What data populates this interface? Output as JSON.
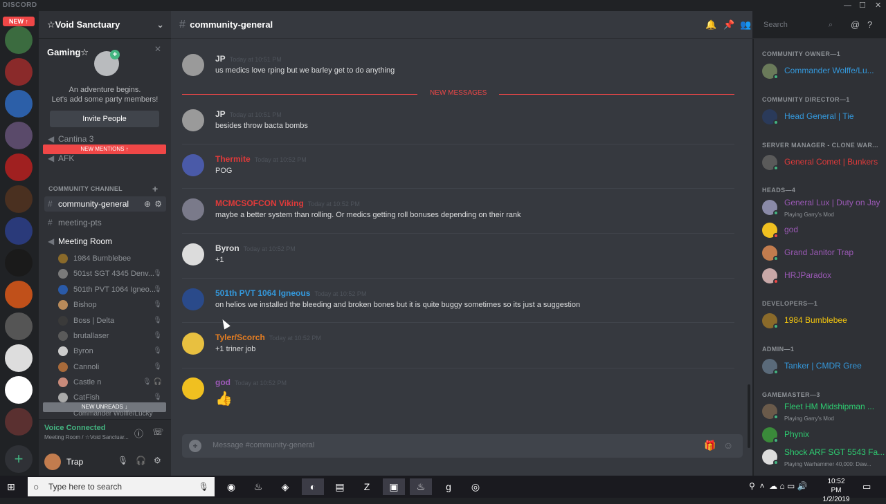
{
  "app": {
    "logo": "DISCORD",
    "minimize": "—",
    "maximize": "☐",
    "close": "✕"
  },
  "guilds": {
    "new_badge": "NEW ↑",
    "add_label": "+"
  },
  "server": {
    "name": "☆Void Sanctuary Gaming☆",
    "chevron": "⌄"
  },
  "invite": {
    "close": "✕",
    "title": "An adventure begins.",
    "subtitle": "Let's add some party members!",
    "button": "Invite People"
  },
  "sidebar": {
    "new_mentions": "NEW MENTIONS ↑",
    "cantina": "Cantina 3",
    "afk": "AFK",
    "category": "COMMUNITY CHANNEL",
    "category_plus": "+",
    "channels": [
      {
        "label": "community-general"
      },
      {
        "label": "meeting-pts"
      }
    ],
    "voice_channel": "Meeting Room",
    "voice_users": [
      "1984 Bumblebee",
      "501st SGT 4345 Denv...",
      "501th PVT 1064 Igneo...",
      "Bishop",
      "Boss | Delta",
      "brutallaser",
      "Byron",
      "Cannoli",
      "Castle n",
      "CatFish",
      "Commander Wolffe/Lucky"
    ],
    "new_unreads": "NEW UNREADS ↓"
  },
  "voice": {
    "status": "Voice Connected",
    "location": "Meeting Room / ☆Void Sanctuar..."
  },
  "user": {
    "name": "Trap"
  },
  "channel": {
    "name": "community-general",
    "search_placeholder": "Search",
    "input_placeholder": "Message #community-general"
  },
  "messages": [
    {
      "author": "JP",
      "time": "Today at 10:51 PM",
      "text": "us medics love rping but we barley get to do anything",
      "color": "#dcddde"
    },
    {
      "author": "JP",
      "time": "Today at 10:51 PM",
      "text": "besides throw bacta bombs",
      "color": "#dcddde"
    },
    {
      "author": "Thermite",
      "time": "Today at 10:52 PM",
      "text": "POG",
      "color": "#e03a3a"
    },
    {
      "author": "MCMCSOFCON Viking",
      "time": "Today at 10:52 PM",
      "text": "maybe a better system than rolling. Or medics getting roll bonuses depending on their rank",
      "color": "#e03a3a"
    },
    {
      "author": "Byron",
      "time": "Today at 10:52 PM",
      "text": "+1",
      "color": "#dcddde"
    },
    {
      "author": "501th PVT 1064 Igneous",
      "time": "Today at 10:52 PM",
      "text": "on helios we installed the bleeding and broken bones but it is quite buggy sometimes so its just a suggestion",
      "color": "#3498db"
    },
    {
      "author": "Tyler/Scorch",
      "time": "Today at 10:52 PM",
      "text": "+1 triner job",
      "color": "#e67e22"
    },
    {
      "author": "god",
      "time": "Today at 10:52 PM",
      "text": "",
      "color": "#9b59b6"
    }
  ],
  "new_messages_label": "NEW MESSAGES",
  "members": {
    "categories": [
      {
        "title": "COMMUNITY OWNER—1"
      },
      {
        "title": "COMMUNITY DIRECTOR—1"
      },
      {
        "title": "SERVER MANAGER - CLONE WAR..."
      },
      {
        "title": "HEADS—4"
      },
      {
        "title": "DEVELOPERS—1"
      },
      {
        "title": "ADMIN—1"
      },
      {
        "title": "GAMEMASTER—3"
      }
    ],
    "list": [
      {
        "name": "Commander Wolffe/Lu...",
        "color": "#3498db",
        "activity": ""
      },
      {
        "name": "Head General | Tie",
        "color": "#3498db",
        "activity": ""
      },
      {
        "name": "General Comet | Bunkers",
        "color": "#e03a3a",
        "activity": ""
      },
      {
        "name": "General Lux | Duty on Jay",
        "color": "#9b59b6",
        "activity": "Playing Garry's Mod"
      },
      {
        "name": "god",
        "color": "#9b59b6",
        "activity": ""
      },
      {
        "name": "Grand Janitor Trap",
        "color": "#9b59b6",
        "activity": ""
      },
      {
        "name": "HRJParadox",
        "color": "#9b59b6",
        "activity": ""
      },
      {
        "name": "1984 Bumblebee",
        "color": "#f1c40f",
        "activity": ""
      },
      {
        "name": "Tanker | CMDR Gree",
        "color": "#3498db",
        "activity": ""
      },
      {
        "name": "Fleet HM Midshipman ...",
        "color": "#2ecc71",
        "activity": "Playing Garry's Mod"
      },
      {
        "name": "Phynix",
        "color": "#2ecc71",
        "activity": ""
      },
      {
        "name": "Shock ARF SGT 5543 Fa...",
        "color": "#2ecc71",
        "activity": "Playing Warhammer 40,000: Daw..."
      }
    ]
  },
  "taskbar": {
    "search_placeholder": "Type here to search",
    "time": "10:52 PM",
    "date": "1/2/2019"
  }
}
